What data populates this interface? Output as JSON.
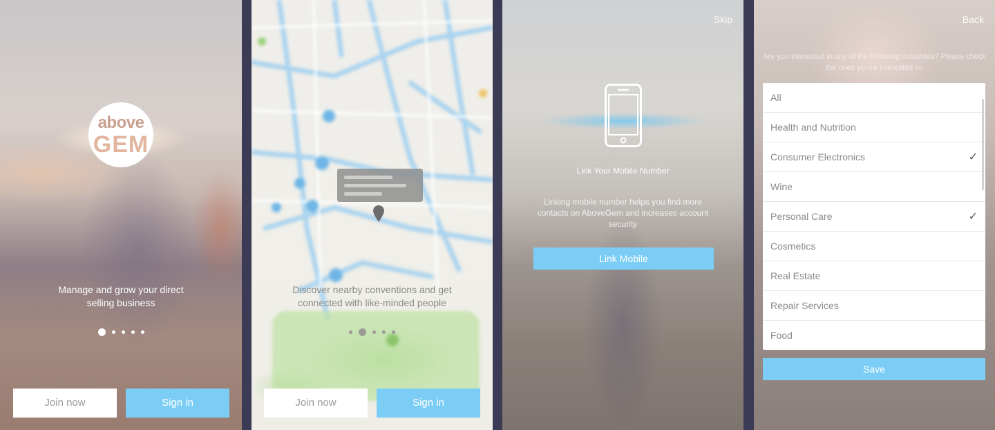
{
  "screen1": {
    "logo": {
      "top": "above",
      "bottom": "GEM"
    },
    "tagline": "Manage and grow your direct selling business",
    "pager": {
      "count": 5,
      "active_index": 0
    },
    "join_label": "Join now",
    "signin_label": "Sign in"
  },
  "screen2": {
    "tagline": "Discover nearby conventions and get connected with like-minded people",
    "pager": {
      "count": 5,
      "active_index": 1
    },
    "join_label": "Join now",
    "signin_label": "Sign in"
  },
  "screen3": {
    "skip_label": "Skip",
    "title": "Link Your Mobile Number",
    "description": "Linking mobile number helps you find more contacts on AboveGem and increases account security",
    "button_label": "Link Mobile"
  },
  "screen4": {
    "back_label": "Back",
    "question": "Are you interested in any of the following industries? Please check the ones you're interested in.",
    "industries": [
      {
        "label": "All",
        "checked": false
      },
      {
        "label": "Health and Nutrition",
        "checked": false
      },
      {
        "label": "Consumer Electronics",
        "checked": true
      },
      {
        "label": "Wine",
        "checked": false
      },
      {
        "label": "Personal Care",
        "checked": true
      },
      {
        "label": "Cosmetics",
        "checked": false
      },
      {
        "label": "Real Estate",
        "checked": false
      },
      {
        "label": "Repair Services",
        "checked": false
      },
      {
        "label": "Food",
        "checked": false
      }
    ],
    "check_glyph": "✓",
    "save_label": "Save"
  },
  "colors": {
    "accent": "#7ccdf5",
    "button_light": "#ffffff",
    "divider": "#3b3b55"
  },
  "icons": {
    "phone": "mobile-phone-icon",
    "check": "checkmark-icon",
    "pin": "map-pin-icon"
  }
}
